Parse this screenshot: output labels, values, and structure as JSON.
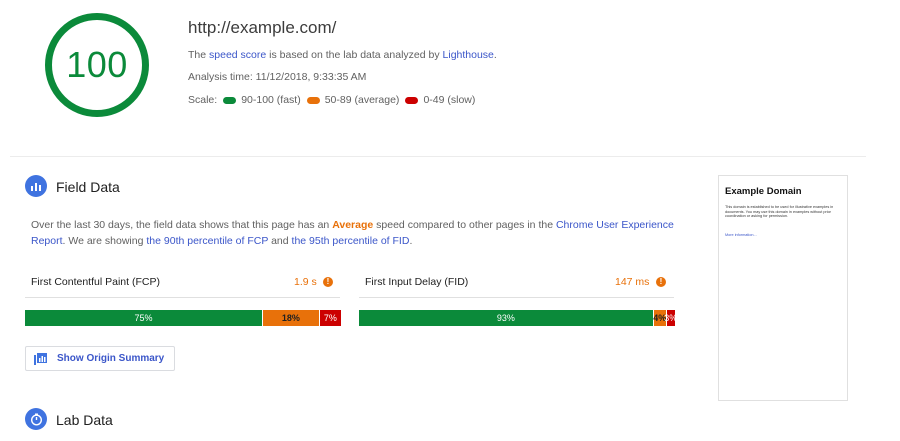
{
  "score": {
    "value": "100",
    "color": "#0b8a3a"
  },
  "summary": {
    "url": "http://example.com/",
    "line1_pre": "The ",
    "line1_link1": "speed score",
    "line1_mid": " is based on the lab data analyzed by ",
    "line1_link2": "Lighthouse",
    "line1_post": ".",
    "analysis_time": "Analysis time: 11/12/2018, 9:33:35 AM",
    "scale_label": "Scale:",
    "scale": [
      {
        "label": "90-100 (fast)",
        "color": "#0b8a3a"
      },
      {
        "label": "50-89 (average)",
        "color": "#e8710a"
      },
      {
        "label": "0-49 (slow)",
        "color": "#cc0000"
      }
    ]
  },
  "field": {
    "title": "Field Data",
    "para_pre": "Over the last 30 days, the field data shows that this page has an ",
    "para_avg": "Average",
    "para_mid1": " speed compared to other pages in the ",
    "para_link1": "Chrome User Experience Report",
    "para_mid2": ". We are showing ",
    "para_link2": "the 90th percentile of FCP",
    "para_mid3": " and ",
    "para_link3": "the 95th percentile of FID",
    "para_post": ".",
    "metrics": [
      {
        "label": "First Contentful Paint (FCP)",
        "value": "1.9 s",
        "fast": 75,
        "average": 18,
        "slow": 7,
        "fast_label": "75%",
        "average_label": "18%",
        "slow_label": "7%"
      },
      {
        "label": "First Input Delay (FID)",
        "value": "147 ms",
        "fast": 93,
        "average": 4,
        "slow": 3,
        "fast_label": "93%",
        "average_label": "4%",
        "slow_label": "3%"
      }
    ],
    "origin_button": "Show Origin Summary"
  },
  "lab": {
    "title": "Lab Data"
  },
  "thumbnail": {
    "title": "Example Domain",
    "body": "This domain is established to be used for illustrative examples in documents. You may use this domain in examples without prior coordination or asking for permission.",
    "link": "More information..."
  },
  "info_icon_glyph": "!"
}
